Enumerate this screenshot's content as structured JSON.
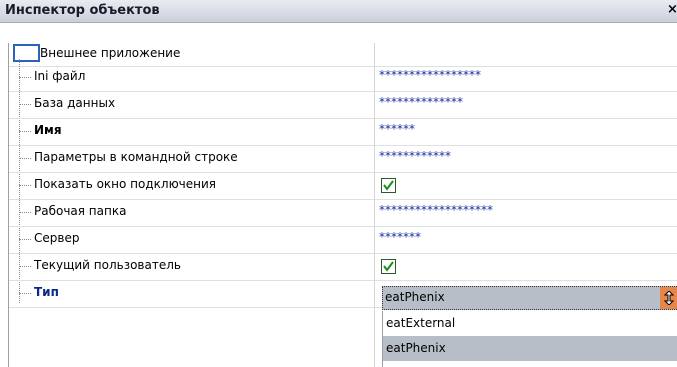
{
  "window": {
    "title": "Инспектор объектов",
    "close_glyph": "×"
  },
  "root": {
    "label": "Внешнее приложение"
  },
  "properties": [
    {
      "name": "Ini файл",
      "value": "*****************",
      "kind": "text",
      "style": "normal"
    },
    {
      "name": "База данных",
      "value": "**************",
      "kind": "text",
      "style": "normal"
    },
    {
      "name": "Имя",
      "value": "******",
      "kind": "text",
      "style": "bold"
    },
    {
      "name": "Параметры в командной строке",
      "value": "************",
      "kind": "text",
      "style": "normal"
    },
    {
      "name": "Показать окно подключения",
      "value": "checked",
      "kind": "checkbox",
      "style": "normal"
    },
    {
      "name": "Рабочая папка",
      "value": "*******************",
      "kind": "text",
      "style": "normal"
    },
    {
      "name": "Сервер",
      "value": "*******",
      "kind": "text",
      "style": "normal"
    },
    {
      "name": "Текущий пользователь",
      "value": "checked",
      "kind": "checkbox",
      "style": "normal"
    },
    {
      "name": "Тип",
      "value": "eatPhenix",
      "kind": "combo",
      "style": "type"
    }
  ],
  "dropdown": {
    "options": [
      "eatExternal",
      "eatPhenix"
    ],
    "selected": "eatPhenix"
  },
  "colors": {
    "accent": "#e8864a",
    "value_text": "#1b2f9c",
    "selection": "#b8bec7",
    "type_label": "#0b2a86"
  }
}
